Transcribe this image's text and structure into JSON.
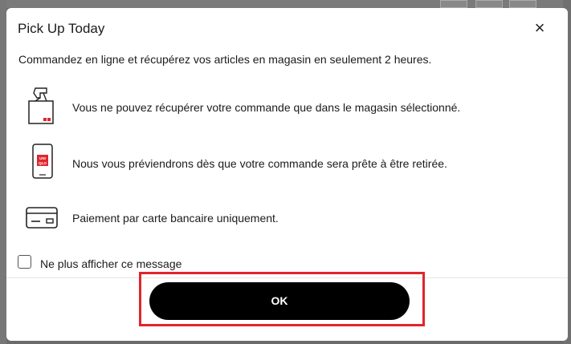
{
  "dialog": {
    "title": "Pick Up Today",
    "close_icon": "close-icon",
    "intro": "Commandez en ligne et récupérez vos articles en magasin en seulement 2 heures.",
    "items": [
      {
        "icon": "pickup-box-icon",
        "text": "Vous ne pouvez récupérer votre commande que dans le magasin sélectionné."
      },
      {
        "icon": "phone-notification-icon",
        "text": "Nous vous préviendrons dès que votre commande sera prête à être retirée."
      },
      {
        "icon": "credit-card-icon",
        "text": "Paiement par carte bancaire uniquement."
      }
    ],
    "checkbox_label": "Ne plus afficher ce message",
    "ok_label": "OK",
    "phone_logo": "UNI QLO"
  },
  "colors": {
    "button": "#000000",
    "highlight": "#e0252d",
    "accent": "#e0252d"
  }
}
